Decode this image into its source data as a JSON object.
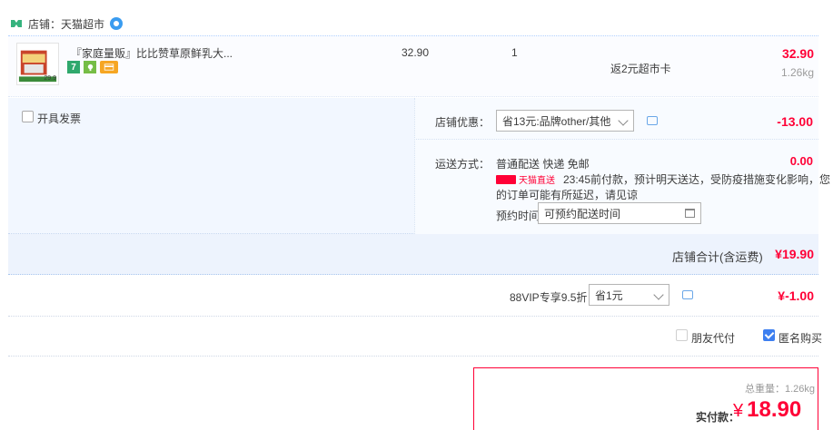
{
  "shop": {
    "label": "店铺：",
    "name": "天猫超市"
  },
  "item": {
    "title": "『家庭量贩』比比赞草原鲜乳大...",
    "unit_price": "32.90",
    "quantity": "1",
    "cashback": "返2元超市卡",
    "subtotal": "32.90",
    "weight": "1.26kg",
    "thumb_price": "29.9"
  },
  "invoice": {
    "label": "开具发票"
  },
  "promo": {
    "label": "店铺优惠：",
    "selected": "省13元:品牌other/其他",
    "amount": "-13.00"
  },
  "shipping": {
    "label": "运送方式：",
    "method": "普通配送 快递 免邮",
    "amount": "0.00",
    "tm_logo": "天猫直送",
    "note_line1": "23:45前付款，预计明天送达，受防疫措施变化影响，您",
    "note_line2": "的订单可能有所延迟，请见谅",
    "appointment_label": "预约时间",
    "appointment_value": "可预约配送时间"
  },
  "store_total": {
    "label": "店铺合计(含运费)",
    "value": "¥19.90"
  },
  "vip": {
    "label": "88VIP专享9.5折",
    "selected": "省1元",
    "amount": "¥-1.00"
  },
  "options": {
    "friend_pay": "朋友代付",
    "anonymous": "匿名购买",
    "anonymous_checked": true
  },
  "payment": {
    "weight_total": "总重量：1.26kg",
    "label": "实付款：",
    "currency": "¥",
    "amount": "18.90"
  },
  "colors": {
    "accent": "#ff0036",
    "blue": "#3d7ff0"
  }
}
